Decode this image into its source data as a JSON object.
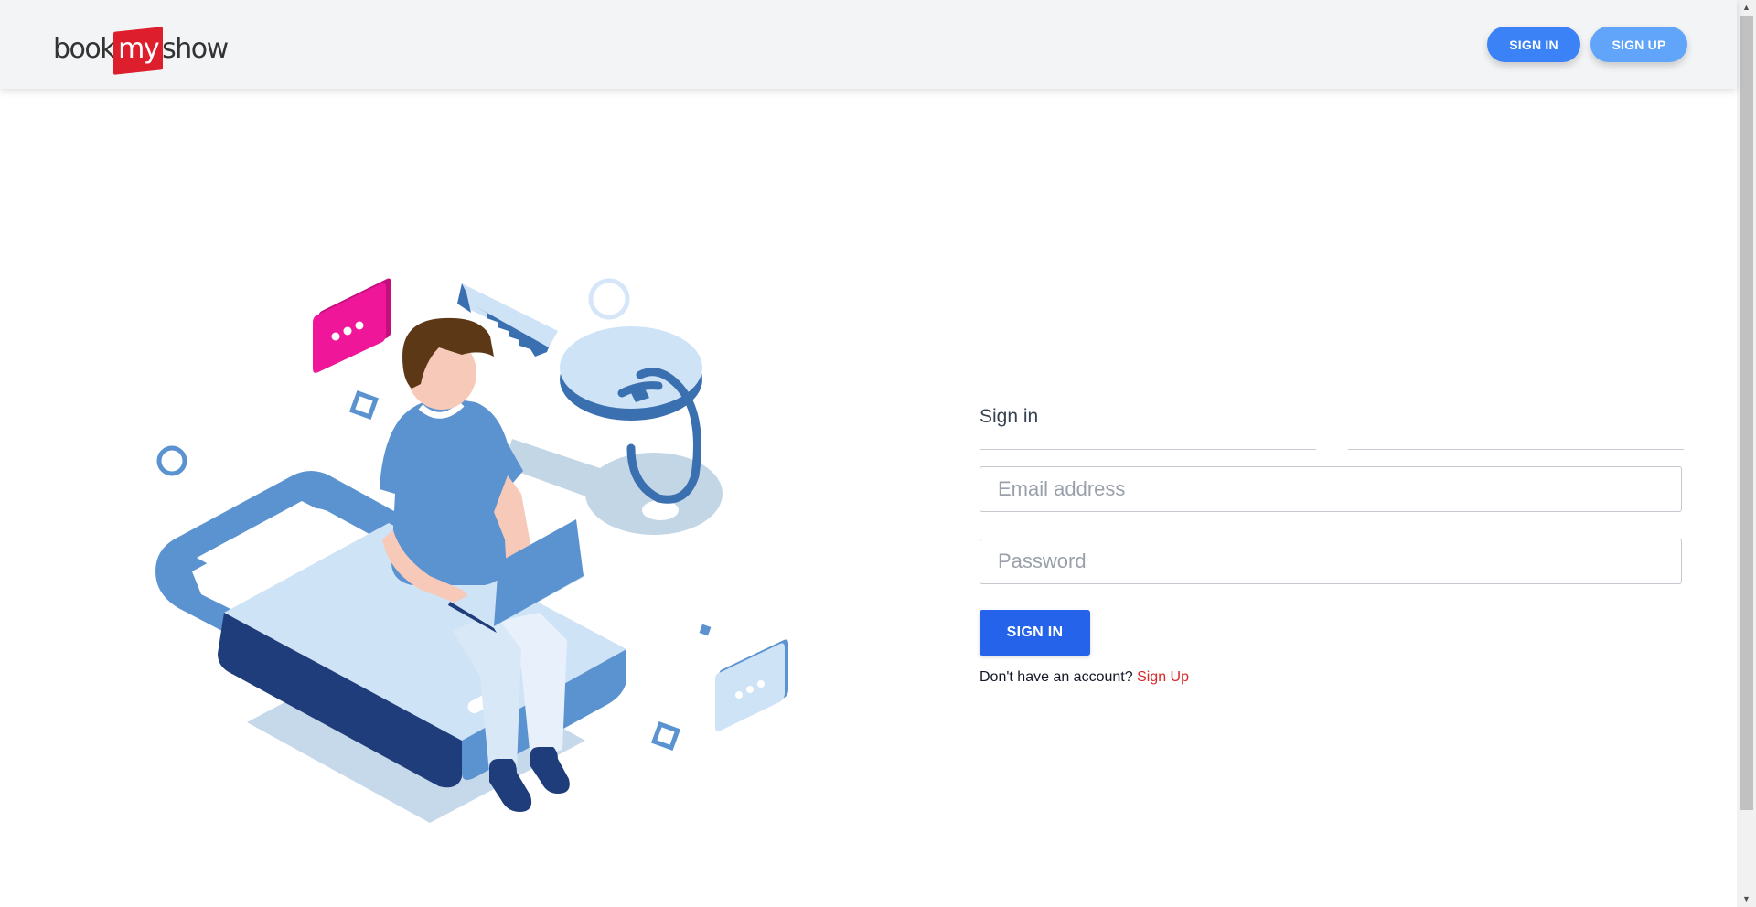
{
  "header": {
    "logo": {
      "part1": "book",
      "part2": "my",
      "part3": "show"
    },
    "signin_label": "SIGN IN",
    "signup_label": "SIGN UP"
  },
  "form": {
    "title": "Sign in",
    "email_placeholder": "Email address",
    "password_placeholder": "Password",
    "submit_label": "SIGN IN",
    "no_account_text": "Don't have an account?",
    "signup_link": "Sign Up"
  },
  "colors": {
    "accent": "#2563eb",
    "header_signin": "#3b82f6",
    "header_signup": "#60a5fa",
    "link": "#dc2626",
    "brand_red": "#dc1e2d",
    "pink_bubble": "#f0169a"
  },
  "icons": [
    "chat-bubble-icon",
    "key-icon",
    "lock-icon",
    "laptop-icon"
  ]
}
